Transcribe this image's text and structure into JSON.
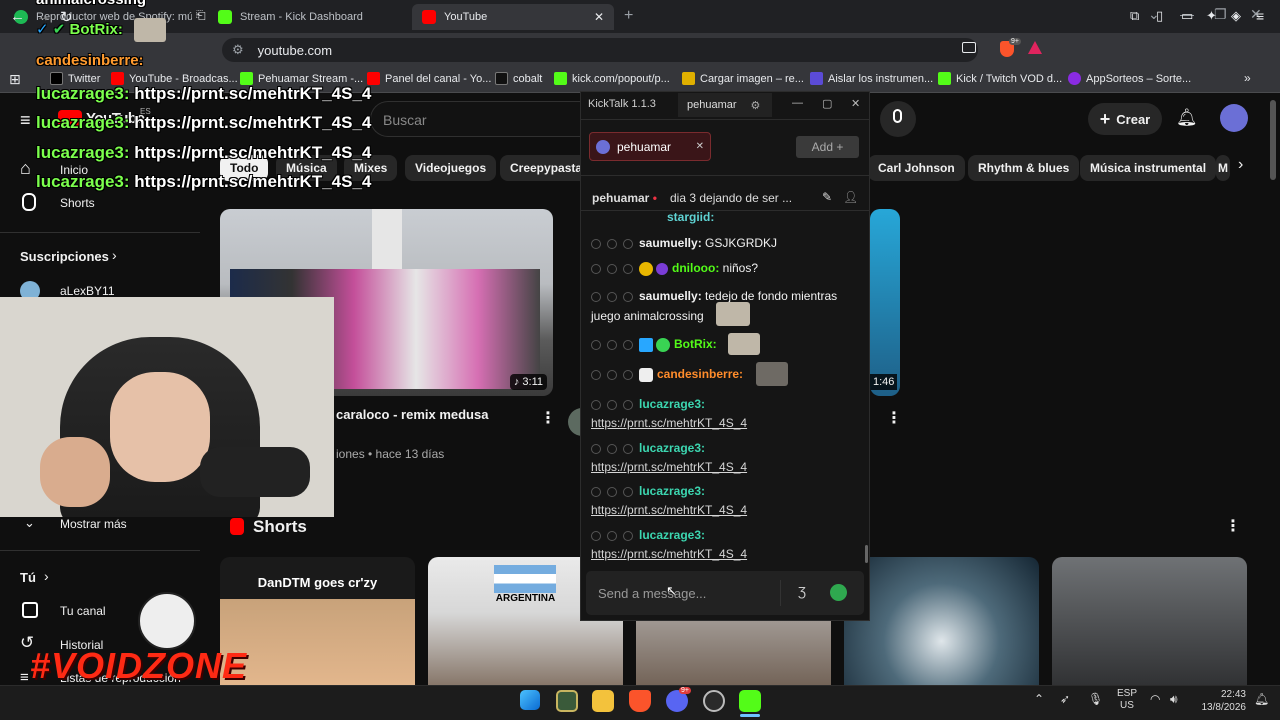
{
  "browser": {
    "tabs": [
      {
        "label": "Reproductor web de Spotify: música",
        "color": "#1db954"
      },
      {
        "label": "Stream - Kick Dashboard",
        "color": "#53fc18"
      },
      {
        "label": "YouTube",
        "color": "#ff0000"
      }
    ],
    "url": "youtube.com",
    "bookmarks": [
      {
        "label": "Twitter",
        "color": "#000000"
      },
      {
        "label": "YouTube - Broadcas...",
        "color": "#ff0000"
      },
      {
        "label": "Pehuamar Stream -...",
        "color": "#53fc18"
      },
      {
        "label": "Panel del canal - Yo...",
        "color": "#ff0000"
      },
      {
        "label": "cobalt",
        "color": "#111111"
      },
      {
        "label": "kick.com/popout/p...",
        "color": "#53fc18"
      },
      {
        "label": "Cargar imagen – re...",
        "color": "#e0b000"
      },
      {
        "label": "Aislar los instrumen...",
        "color": "#5b4bd6"
      },
      {
        "label": "Kick / Twitch VOD d...",
        "color": "#53fc18"
      },
      {
        "label": "AppSorteos – Sorte...",
        "color": "#8a2be2"
      }
    ],
    "notif_badge": "9+"
  },
  "youtube": {
    "logo": "YouTube",
    "logo_sup": "ES",
    "search_placeholder": "Buscar",
    "create_label": "Crear",
    "chips": [
      "Todo",
      "Música",
      "Mixes",
      "Videojuegos",
      "Creepypastas",
      "Carl Johnson",
      "Rhythm & blues",
      "Música instrumental",
      "M"
    ],
    "sidebar": {
      "inicio": "Inicio",
      "shorts": "Shorts",
      "suscripciones": "Suscripciones",
      "sub1": "aLexBY11",
      "mostrar_mas": "Mostrar más",
      "tu": "Tú",
      "tu_canal": "Tu canal",
      "historial": "Historial",
      "listas": "Listas de reproducción"
    },
    "video1": {
      "title": "caraloco - remix medusa",
      "meta": "iones • hace 13 días",
      "duration": "3:11"
    },
    "video2": {
      "duration": "1:46"
    },
    "shorts_title": "Shorts",
    "short1_text": "DanDTM goes cr'zy",
    "short2_text": "ARGENTINA"
  },
  "overlay": {
    "top_lines": [
      {
        "text": "animalcrossing"
      },
      {
        "user": "BotRix:"
      },
      {
        "user": "candesinberre:"
      }
    ],
    "link_lines": [
      {
        "user": "lucazrage3:",
        "text": " https://prnt.sc/mehtrKT_4S_4"
      },
      {
        "user": "lucazrage3:",
        "text": " https://prnt.sc/mehtrKT_4S_4"
      },
      {
        "user": "lucazrage3:",
        "text": " https://prnt.sc/mehtrKT_4S_4"
      },
      {
        "user": "lucazrage3:",
        "text": " https://prnt.sc/mehtrKT_4S_4"
      }
    ],
    "voidzone": "#VOIDZONE"
  },
  "kicktalk": {
    "title": "KickTalk 1.1.3",
    "tab_user": "pehuamar",
    "chip_user": "pehuamar",
    "add_label": "Add",
    "stream_user": "pehuamar",
    "stream_title": "dia 3 dejando de ser ...",
    "messages": [
      {
        "user": "stargiid:",
        "text": "",
        "color": "#5fd3d3"
      },
      {
        "user": "saumuelly:",
        "text": " GSJKGRDKJ",
        "color": "#ffffff"
      },
      {
        "user": "dnilooo:",
        "text": " niños?",
        "color": "#53fc18"
      },
      {
        "user": "saumuelly:",
        "text": " tedejo de fondo mientras juego animalcrossing",
        "color": "#ffffff"
      },
      {
        "user": "BotRix:",
        "text": "",
        "color": "#53fc18"
      },
      {
        "user": "candesinberre:",
        "text": "",
        "color": "#ff8c2b"
      },
      {
        "user": "lucazrage3:",
        "text": "https://prnt.sc/mehtrKT_4S_4",
        "color": "#3cd6b0"
      },
      {
        "user": "lucazrage3:",
        "text": "https://prnt.sc/mehtrKT_4S_4",
        "color": "#3cd6b0"
      },
      {
        "user": "lucazrage3:",
        "text": "https://prnt.sc/mehtrKT_4S_4",
        "color": "#3cd6b0"
      },
      {
        "user": "lucazrage3:",
        "text": "https://prnt.sc/mehtrKT_4S_4",
        "color": "#3cd6b0"
      }
    ],
    "input_placeholder": "Send a message..."
  },
  "taskbar": {
    "lang": "ESP",
    "region": "US",
    "time": "22:43",
    "date": "13/8/2026",
    "discord_badge": "9+"
  }
}
